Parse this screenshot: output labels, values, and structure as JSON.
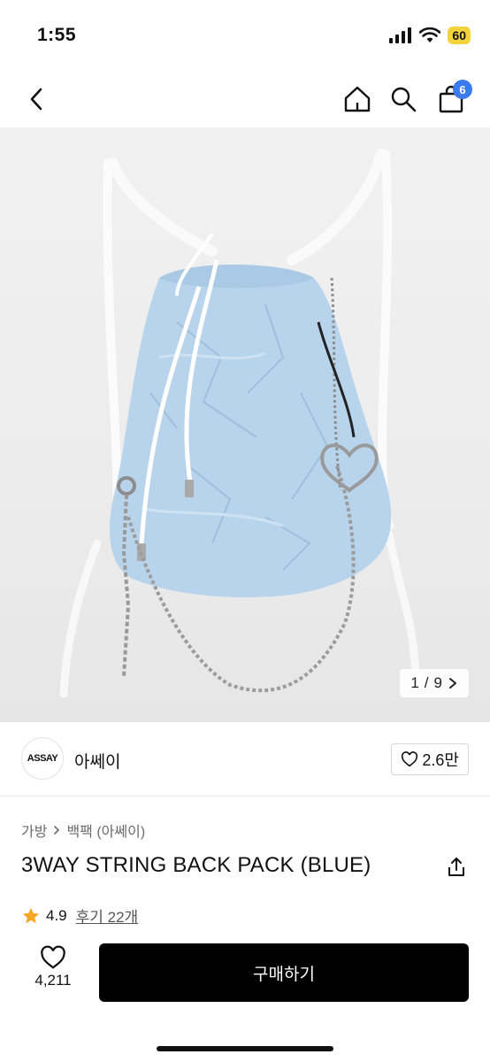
{
  "status_bar": {
    "time": "1:55",
    "battery": "60"
  },
  "nav": {
    "cart_count": "6"
  },
  "gallery": {
    "current": "1",
    "separator": "/",
    "total": "9"
  },
  "brand": {
    "logo_text": "ASSAY",
    "name": "아쎄이",
    "likes": "2.6만"
  },
  "breadcrumb": {
    "category": "가방",
    "subcategory": "백팩 (아쎄이)"
  },
  "product": {
    "title": "3WAY STRING BACK PACK (BLUE)"
  },
  "rating": {
    "value": "4.9",
    "reviews": "후기 22개"
  },
  "bottom": {
    "like_count": "4,211",
    "buy_label": "구매하기"
  },
  "colors": {
    "bag": "#b7d4ec",
    "accent_badge": "#3a7bf0",
    "star": "#f5a623",
    "battery": "#f2d33b"
  }
}
